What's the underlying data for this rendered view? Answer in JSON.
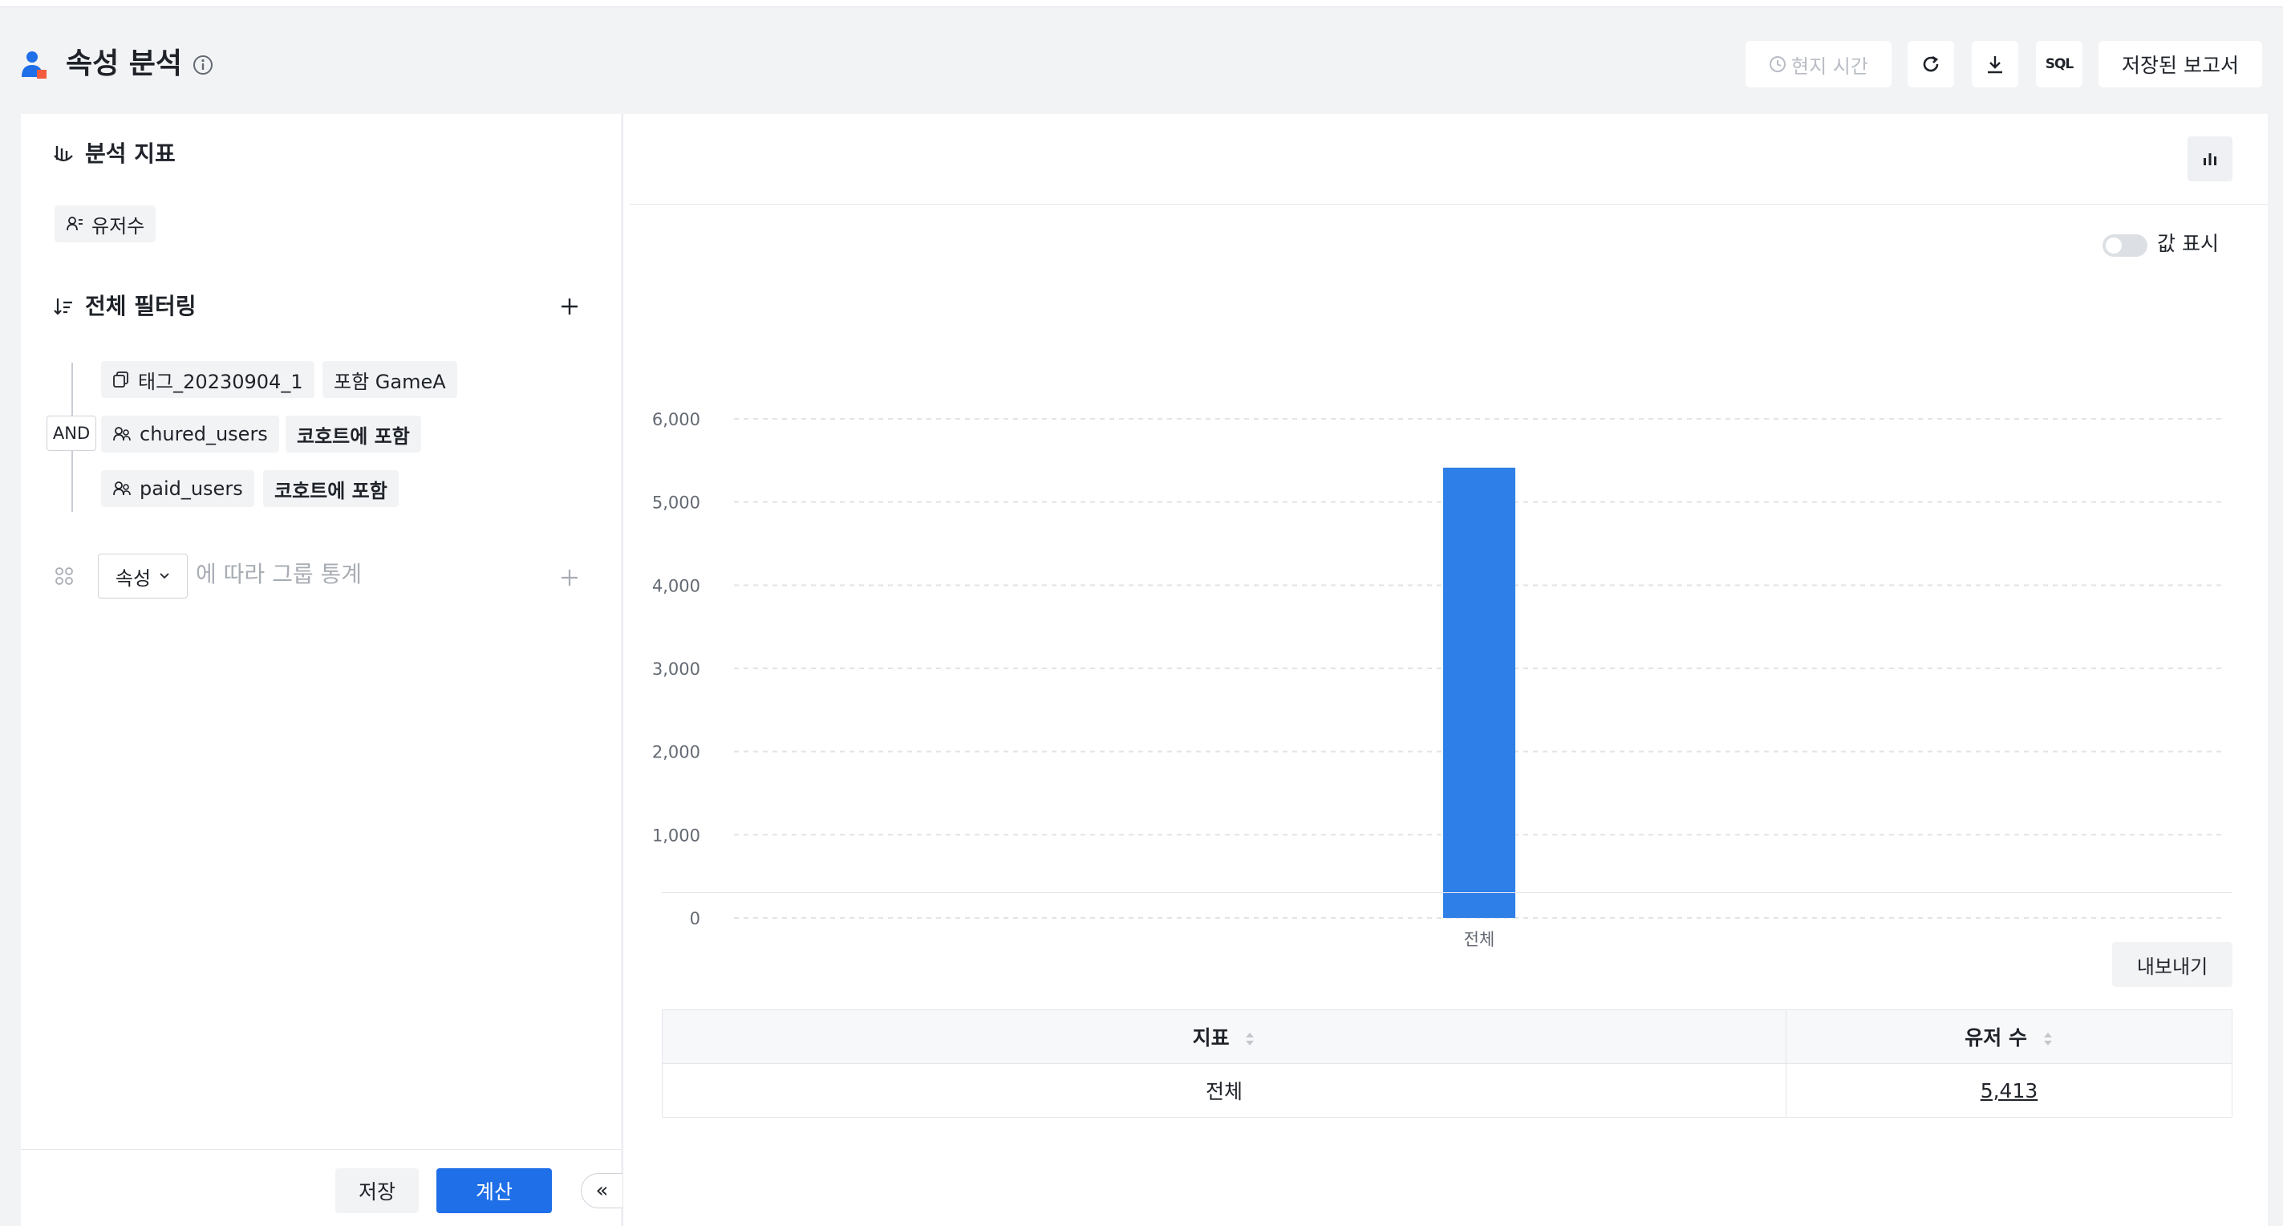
{
  "header": {
    "title": "속성 분석",
    "timezone_label": "현지 시간",
    "sql_label": "SQL",
    "saved_reports_label": "저장된 보고서"
  },
  "left": {
    "metrics_title": "분석 지표",
    "metric_chip": "유저수",
    "filter_title": "전체 필터링",
    "logic_label": "AND",
    "filters": [
      {
        "field": "태그_20230904_1",
        "condition": "포함 GameA"
      },
      {
        "field": "chured_users",
        "condition": "코호트에 포함"
      },
      {
        "field": "paid_users",
        "condition": "코호트에 포함"
      }
    ],
    "group_select": "속성",
    "group_placeholder": "에 따라 그룹 통계",
    "save_label": "저장",
    "calc_label": "계산",
    "collapse_glyph": "«"
  },
  "right": {
    "show_values_label": "값 표시",
    "show_values_on": false,
    "export_label": "내보내기",
    "table": {
      "headers": [
        "지표",
        "유저 수"
      ],
      "rows": [
        [
          "전체",
          "5,413"
        ]
      ]
    }
  },
  "chart_data": {
    "type": "bar",
    "categories": [
      "전체"
    ],
    "values": [
      5413
    ],
    "ylim": [
      0,
      6000
    ],
    "yticks": [
      0,
      1000,
      2000,
      3000,
      4000,
      5000,
      6000
    ],
    "ytick_labels": [
      "0",
      "1,000",
      "2,000",
      "3,000",
      "4,000",
      "5,000",
      "6,000"
    ],
    "grid": true,
    "bar_color": "#2f7fe8"
  },
  "colors": {
    "accent": "#1e6fe8",
    "bar": "#2f7fe8"
  }
}
